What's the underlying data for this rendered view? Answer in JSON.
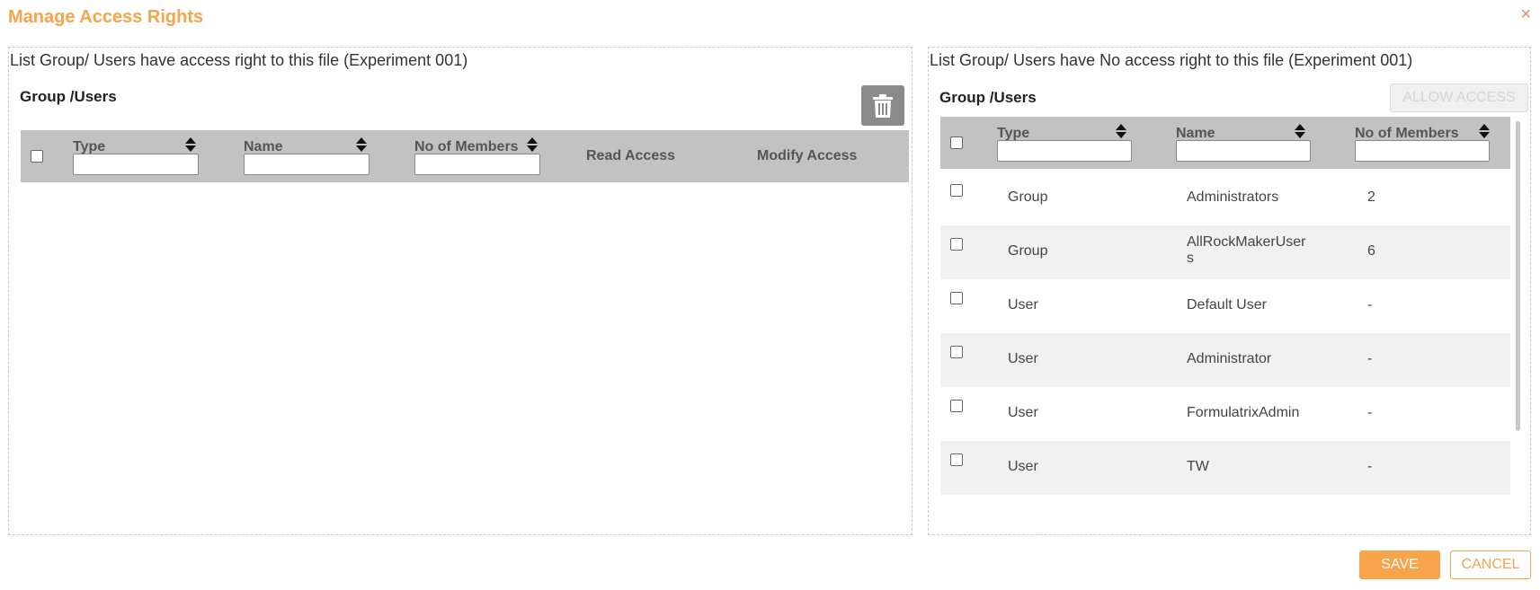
{
  "dialog": {
    "title": "Manage Access Rights",
    "close_icon": "×"
  },
  "left_panel": {
    "caption": "List Group/ Users have access right to this file (Experiment 001)",
    "section_title": "Group /Users",
    "delete_icon": "trash-icon",
    "columns": {
      "type": "Type",
      "name": "Name",
      "members": "No of Members",
      "read": "Read Access",
      "modify": "Modify Access"
    },
    "filters": {
      "type": "",
      "name": "",
      "members": ""
    }
  },
  "right_panel": {
    "caption": "List Group/ Users have No access right to this file (Experiment 001)",
    "section_title": "Group /Users",
    "allow_label": "ALLOW ACCESS",
    "columns": {
      "type": "Type",
      "name": "Name",
      "members": "No of Members"
    },
    "filters": {
      "type": "",
      "name": "",
      "members": ""
    },
    "rows": [
      {
        "type": "Group",
        "name": "Administrators",
        "members": "2"
      },
      {
        "type": "Group",
        "name": "AllRockMakerUsers",
        "members": "6"
      },
      {
        "type": "User",
        "name": "Default User",
        "members": "-"
      },
      {
        "type": "User",
        "name": "Administrator",
        "members": "-"
      },
      {
        "type": "User",
        "name": "FormulatrixAdmin",
        "members": "-"
      },
      {
        "type": "User",
        "name": "TW",
        "members": "-"
      }
    ]
  },
  "footer": {
    "save_label": "SAVE",
    "cancel_label": "CANCEL"
  },
  "colors": {
    "accent": "#f7a44a",
    "header_bg": "#c2c2c2",
    "row_alt": "#f1f1f1"
  }
}
